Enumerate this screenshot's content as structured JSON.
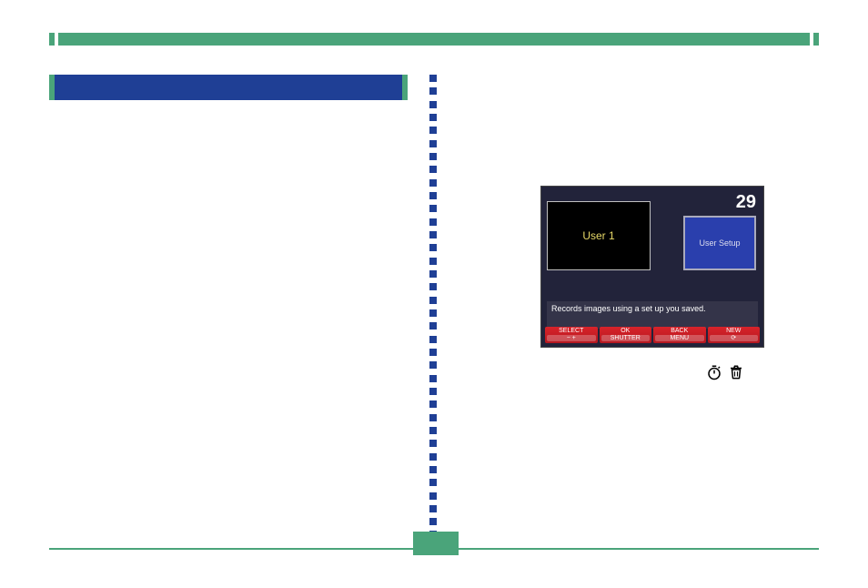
{
  "screenshot": {
    "user_label": "User 1",
    "counter": "29",
    "right_button": "User Setup",
    "description": "Records images using a set up you saved.",
    "buttons": {
      "b1": {
        "top": "SELECT",
        "bottom": "− +"
      },
      "b2": {
        "top": "OK",
        "bottom": "SHUTTER"
      },
      "b3": {
        "top": "BACK",
        "bottom": "MENU"
      },
      "b4": {
        "top": "NEW",
        "bottom": "⟳"
      }
    }
  },
  "icons": {
    "timer": "timer-icon",
    "trash": "trash-icon"
  }
}
